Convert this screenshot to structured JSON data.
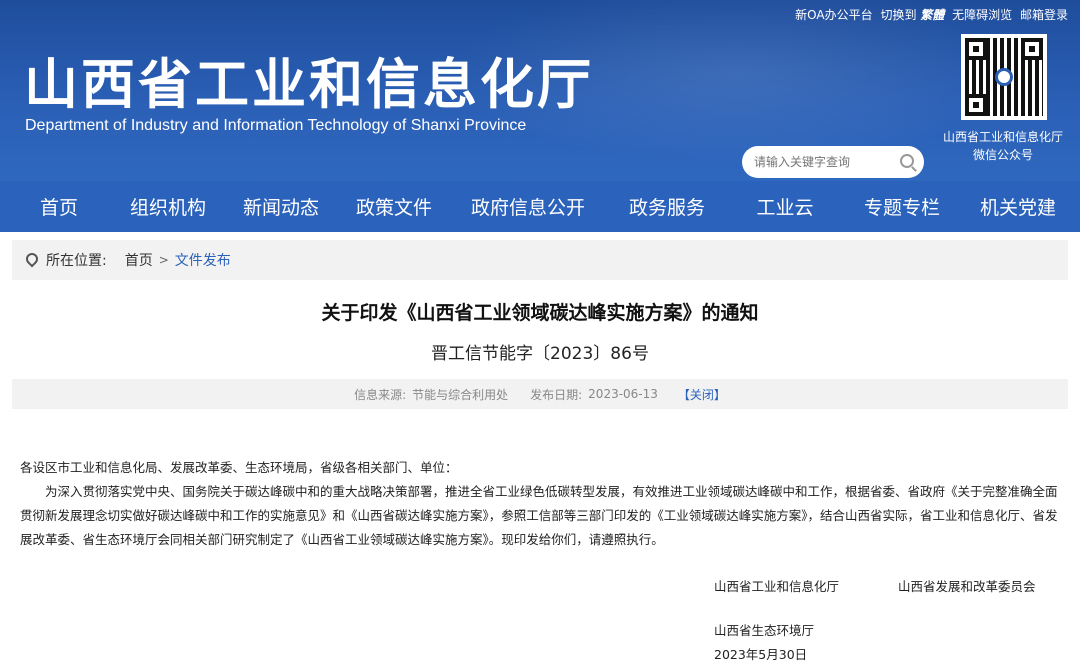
{
  "header": {
    "top_links": [
      "新OA办公平台",
      "切换到",
      "繁體",
      "无障碍浏览",
      "邮箱登录"
    ],
    "title": "山西省工业和信息化厅",
    "subtitle": "Department of Industry and Information Technology of Shanxi Province",
    "qr_caption_line1": "山西省工业和信息化厅",
    "qr_caption_line2": "微信公众号",
    "search_placeholder": "请输入关键字查询"
  },
  "nav": {
    "items": [
      {
        "label": "首页"
      },
      {
        "label": "组织机构"
      },
      {
        "label": "新闻动态"
      },
      {
        "label": "政策文件"
      },
      {
        "label": "政府信息公开"
      },
      {
        "label": "政务服务"
      },
      {
        "label": "工业云"
      },
      {
        "label": "专题专栏"
      },
      {
        "label": "机关党建"
      }
    ]
  },
  "breadcrumb": {
    "label": "所在位置:",
    "home": "首页",
    "separator": ">",
    "current": "文件发布"
  },
  "article": {
    "title": "关于印发《山西省工业领域碳达峰实施方案》的通知",
    "doc_number": "晋工信节能字〔2023〕86号",
    "meta": {
      "source_label": "信息来源:",
      "source": "节能与综合利用处",
      "date_label": "发布日期:",
      "date": "2023-06-13",
      "close_label": "【关闭】"
    },
    "salutation": "各设区市工业和信息化局、发展改革委、生态环境局，省级各相关部门、单位：",
    "paragraph": "为深入贯彻落实党中央、国务院关于碳达峰碳中和的重大战略决策部署，推进全省工业绿色低碳转型发展，有效推进工业领域碳达峰碳中和工作，根据省委、省政府《关于完整准确全面贯彻新发展理念切实做好碳达峰碳中和工作的实施意见》和《山西省碳达峰实施方案》，参照工信部等三部门印发的《工业领域碳达峰实施方案》，结合山西省实际，省工业和信息化厅、省发展改革委、省生态环境厅会同相关部门研究制定了《山西省工业领域碳达峰实施方案》。现印发给你们，请遵照执行。",
    "signatories": {
      "org1": "山西省工业和信息化厅",
      "org2": "山西省发展和改革委员会",
      "org3": "山西省生态环境厅",
      "date": "2023年5月30日"
    }
  },
  "colors": {
    "banner": "#2a5fb5",
    "nav": "#2b62bb",
    "link": "#2b62bb",
    "meta_bg": "#f2f2f2"
  }
}
